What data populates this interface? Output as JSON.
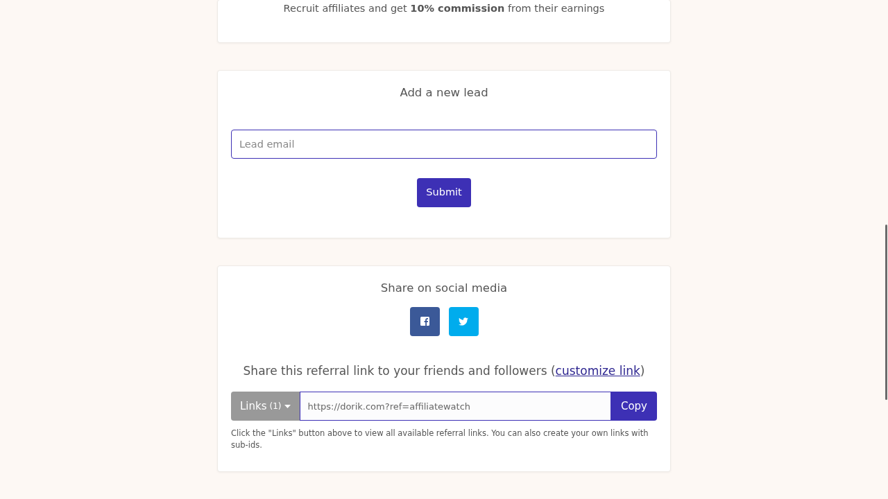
{
  "intro": {
    "text": "Recruit affiliates and get **10% commission** from their earnings"
  },
  "lead_form": {
    "title": "Add a new lead",
    "email_placeholder": "Lead email",
    "submit": "Submit"
  },
  "share": {
    "title": "Share on social media",
    "social_buttons": [
      {
        "kind": "facebook",
        "color": "#3b5998"
      },
      {
        "kind": "twitter",
        "color": "#00aced"
      }
    ],
    "referral_prefix": "Share this referral link to your friends and followers (",
    "referral_link": "customize link",
    "referral_suffix": ")",
    "links_button": {
      "label": "Links",
      "count": "(1)"
    },
    "url": "https://dorik.com?ref=affiliatewatch",
    "copy": "Copy",
    "help": "Click the \"Links\" button above to view all available referral links. You can also create your own links with sub-ids."
  }
}
